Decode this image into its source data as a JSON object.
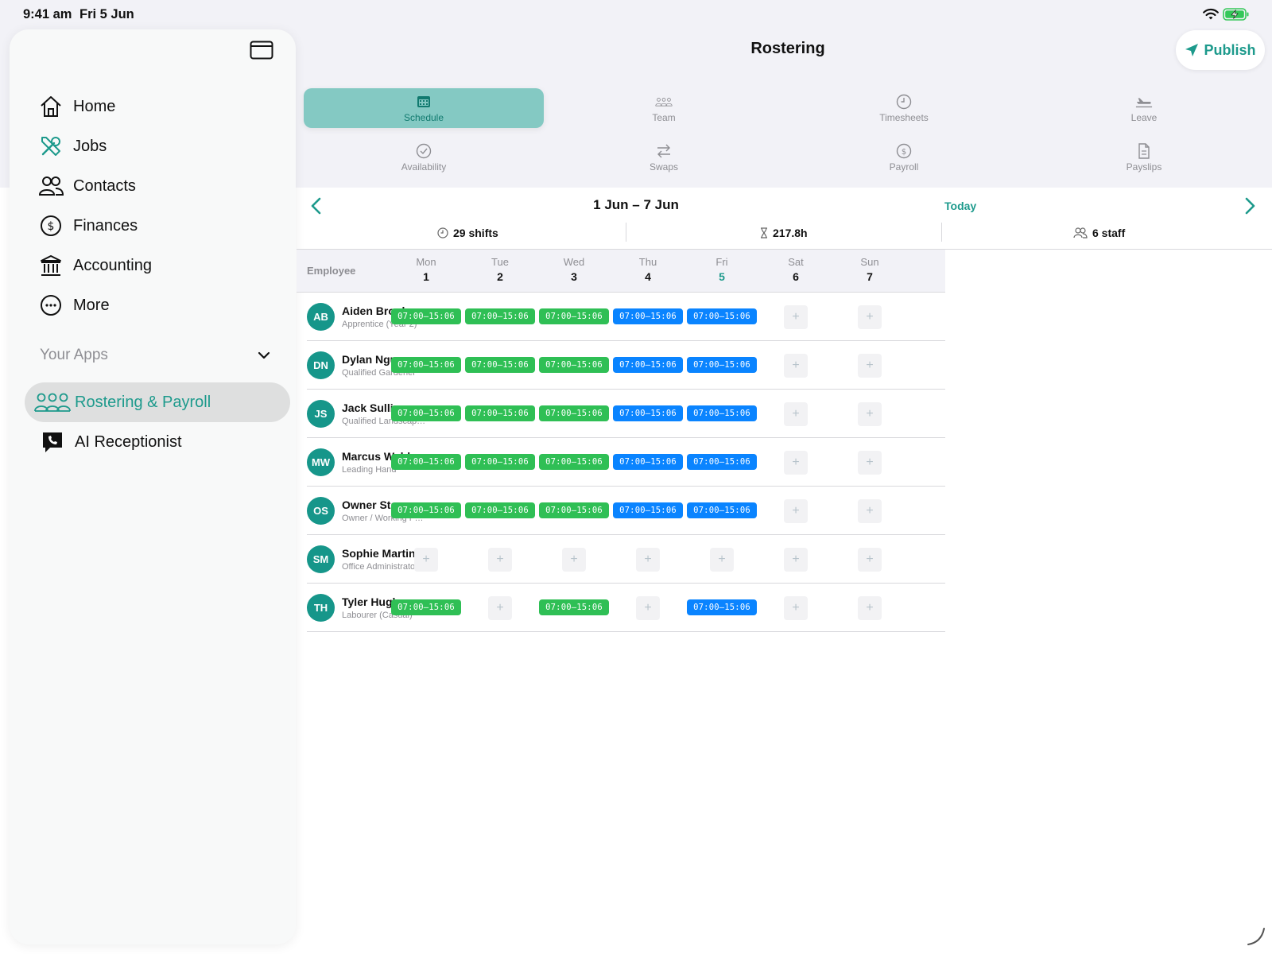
{
  "status_bar": {
    "time": "9:41 am",
    "date": "Fri 5 Jun"
  },
  "sidebar": {
    "items": [
      {
        "label": "Home",
        "icon": "house-icon"
      },
      {
        "label": "Jobs",
        "icon": "tools-icon"
      },
      {
        "label": "Contacts",
        "icon": "people-icon"
      },
      {
        "label": "Finances",
        "icon": "dollar-circle-icon"
      },
      {
        "label": "Accounting",
        "icon": "bank-icon"
      },
      {
        "label": "More",
        "icon": "ellipsis-circle-icon"
      }
    ],
    "your_apps_label": "Your Apps",
    "apps": [
      {
        "label": "Rostering & Payroll",
        "icon": "team-icon",
        "selected": true
      },
      {
        "label": "AI Receptionist",
        "icon": "phone-bubble-icon",
        "selected": false
      }
    ]
  },
  "header": {
    "title": "Rostering",
    "publish_label": "Publish"
  },
  "tabs": [
    {
      "label": "Schedule",
      "icon": "calendar-icon",
      "active": true
    },
    {
      "label": "Team",
      "icon": "team-icon",
      "active": false
    },
    {
      "label": "Timesheets",
      "icon": "clock-icon",
      "active": false
    },
    {
      "label": "Leave",
      "icon": "airplane-icon",
      "active": false
    },
    {
      "label": "Availability",
      "icon": "check-circle-icon",
      "active": false
    },
    {
      "label": "Swaps",
      "icon": "swap-arrows-icon",
      "active": false
    },
    {
      "label": "Payroll",
      "icon": "dollar-circle-icon",
      "active": false
    },
    {
      "label": "Payslips",
      "icon": "document-icon",
      "active": false
    }
  ],
  "week": {
    "range": "1 Jun – 7 Jun",
    "today_label": "Today",
    "stats": {
      "shifts": "29 shifts",
      "hours": "217.8h",
      "staff": "6 staff"
    }
  },
  "grid": {
    "employee_header": "Employee",
    "days": [
      {
        "name": "Mon",
        "date": "1",
        "today": false
      },
      {
        "name": "Tue",
        "date": "2",
        "today": false
      },
      {
        "name": "Wed",
        "date": "3",
        "today": false
      },
      {
        "name": "Thu",
        "date": "4",
        "today": false
      },
      {
        "name": "Fri",
        "date": "5",
        "today": true
      },
      {
        "name": "Sat",
        "date": "6",
        "today": false
      },
      {
        "name": "Sun",
        "date": "7",
        "today": false
      }
    ],
    "rows": [
      {
        "initials": "AB",
        "name": "Aiden Brooks",
        "role": "Apprentice (Year 2)",
        "shifts": [
          {
            "time": "07:00–15:06",
            "color": "green"
          },
          {
            "time": "07:00–15:06",
            "color": "green"
          },
          {
            "time": "07:00–15:06",
            "color": "green"
          },
          {
            "time": "07:00–15:06",
            "color": "blue"
          },
          {
            "time": "07:00–15:06",
            "color": "blue"
          },
          null,
          null
        ]
      },
      {
        "initials": "DN",
        "name": "Dylan Nguyen",
        "role": "Qualified Gardener",
        "shifts": [
          {
            "time": "07:00–15:06",
            "color": "green"
          },
          {
            "time": "07:00–15:06",
            "color": "green"
          },
          {
            "time": "07:00–15:06",
            "color": "green"
          },
          {
            "time": "07:00–15:06",
            "color": "blue"
          },
          {
            "time": "07:00–15:06",
            "color": "blue"
          },
          null,
          null
        ]
      },
      {
        "initials": "JS",
        "name": "Jack Sullivan",
        "role": "Qualified Landscap…",
        "shifts": [
          {
            "time": "07:00–15:06",
            "color": "green"
          },
          {
            "time": "07:00–15:06",
            "color": "green"
          },
          {
            "time": "07:00–15:06",
            "color": "green"
          },
          {
            "time": "07:00–15:06",
            "color": "blue"
          },
          {
            "time": "07:00–15:06",
            "color": "blue"
          },
          null,
          null
        ]
      },
      {
        "initials": "MW",
        "name": "Marcus Webb",
        "role": "Leading Hand",
        "shifts": [
          {
            "time": "07:00–15:06",
            "color": "green"
          },
          {
            "time": "07:00–15:06",
            "color": "green"
          },
          {
            "time": "07:00–15:06",
            "color": "green"
          },
          {
            "time": "07:00–15:06",
            "color": "blue"
          },
          {
            "time": "07:00–15:06",
            "color": "blue"
          },
          null,
          null
        ]
      },
      {
        "initials": "OS",
        "name": "Owner Stages",
        "role": "Owner / Working F…",
        "shifts": [
          {
            "time": "07:00–15:06",
            "color": "green"
          },
          {
            "time": "07:00–15:06",
            "color": "green"
          },
          {
            "time": "07:00–15:06",
            "color": "green"
          },
          {
            "time": "07:00–15:06",
            "color": "blue"
          },
          {
            "time": "07:00–15:06",
            "color": "blue"
          },
          null,
          null
        ]
      },
      {
        "initials": "SM",
        "name": "Sophie Martin",
        "role": "Office Administrator",
        "shifts": [
          null,
          null,
          null,
          null,
          null,
          null,
          null
        ]
      },
      {
        "initials": "TH",
        "name": "Tyler Hughes",
        "role": "Labourer (Casual)",
        "shifts": [
          {
            "time": "07:00–15:06",
            "color": "green"
          },
          null,
          {
            "time": "07:00–15:06",
            "color": "green"
          },
          null,
          {
            "time": "07:00–15:06",
            "color": "blue"
          },
          null,
          null
        ]
      }
    ],
    "add_symbol": "+"
  },
  "colors": {
    "accent": "#1d9a8c",
    "shift_green": "#2fbf55",
    "shift_blue": "#0a84ff",
    "avatar": "#16968a",
    "active_tab": "#84c9c3"
  }
}
